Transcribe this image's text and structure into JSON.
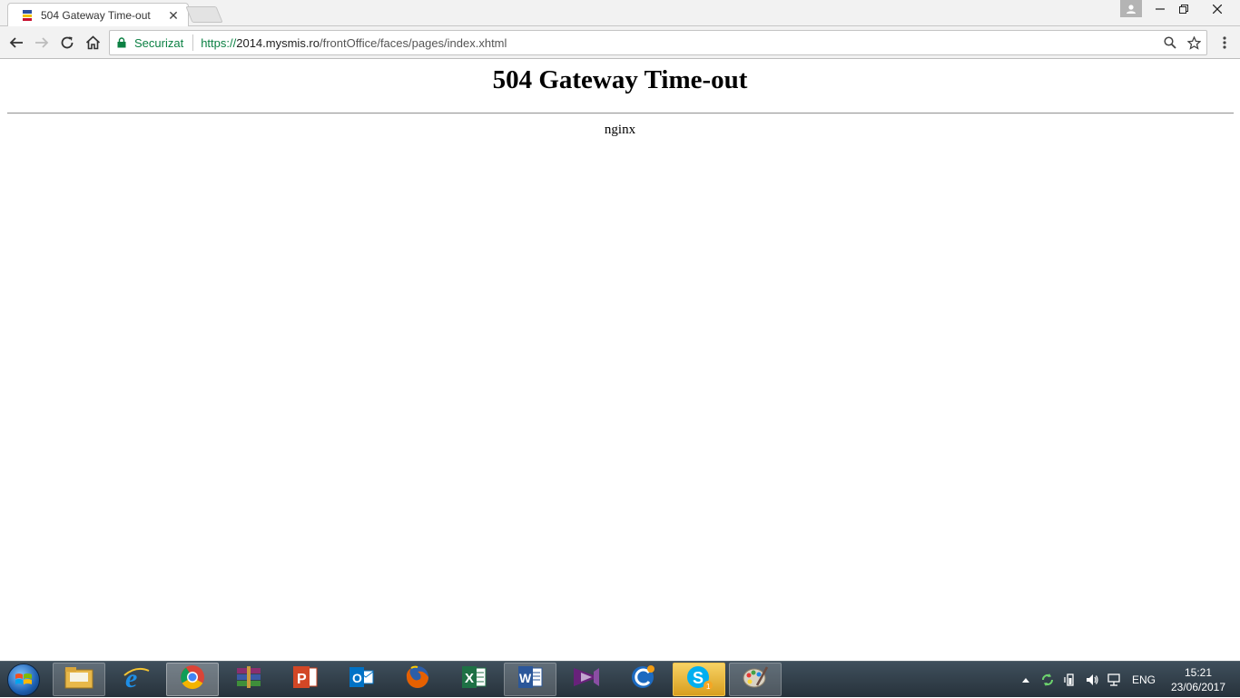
{
  "browser": {
    "tab": {
      "title": "504 Gateway Time-out",
      "close_icon": "close-icon",
      "favicon": "page-favicon"
    },
    "omnibox": {
      "security_label": "Securizat",
      "url_scheme": "https://",
      "url_host": "2014.mysmis.ro",
      "url_path": "/frontOffice/faces/pages/index.xhtml"
    },
    "colors": {
      "secure_green": "#0b8043",
      "tab_bg": "#f2f2f2"
    }
  },
  "page": {
    "heading": "504 Gateway Time-out",
    "server": "nginx"
  },
  "taskbar": {
    "apps": [
      {
        "name": "file-explorer",
        "icon": "folder-icon"
      },
      {
        "name": "internet-explorer",
        "icon": "ie-icon"
      },
      {
        "name": "chrome",
        "icon": "chrome-icon",
        "active": true
      },
      {
        "name": "winrar",
        "icon": "winrar-icon"
      },
      {
        "name": "powerpoint",
        "icon": "powerpoint-icon"
      },
      {
        "name": "outlook",
        "icon": "outlook-icon"
      },
      {
        "name": "firefox",
        "icon": "firefox-icon"
      },
      {
        "name": "excel",
        "icon": "excel-icon"
      },
      {
        "name": "word",
        "icon": "word-icon"
      },
      {
        "name": "visual-studio",
        "icon": "visual-studio-icon"
      },
      {
        "name": "ccleaner",
        "icon": "ccleaner-icon"
      },
      {
        "name": "skype",
        "icon": "skype-icon",
        "badge": "1"
      },
      {
        "name": "paint",
        "icon": "paint-icon"
      }
    ],
    "tray": {
      "language": "ENG",
      "time": "15:21",
      "date": "23/06/2017"
    }
  }
}
